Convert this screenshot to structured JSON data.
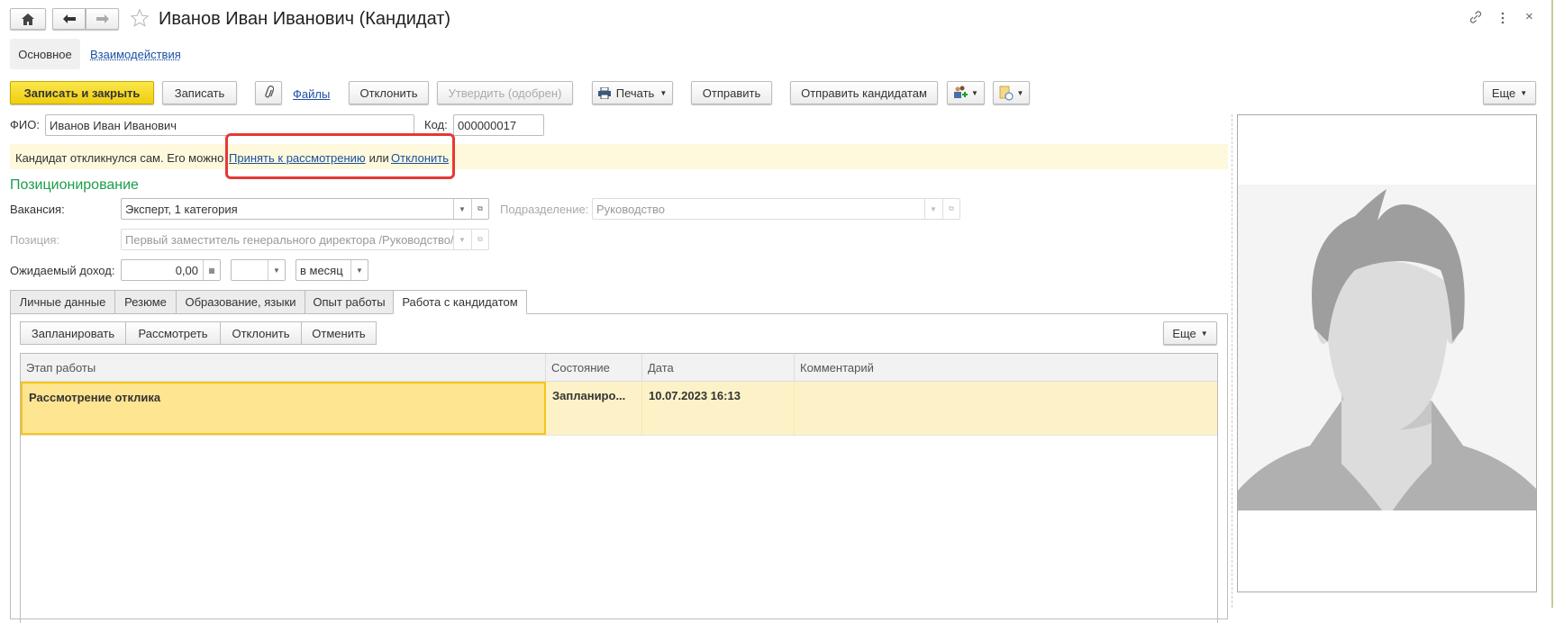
{
  "window": {
    "title": "Иванов Иван Иванович (Кандидат)"
  },
  "nav": {
    "home_icon": "home-icon",
    "back_icon": "arrow-left-icon",
    "forward_icon": "arrow-right-icon",
    "star_icon": "star-icon"
  },
  "form_tabs": [
    {
      "label": "Основное",
      "active": true
    },
    {
      "label": "Взаимодействия",
      "active": false
    }
  ],
  "toolbar": {
    "save_close": "Записать и закрыть",
    "save": "Записать",
    "files": "Файлы",
    "reject": "Отклонить",
    "approve": "Утвердить (одобрен)",
    "print": "Печать",
    "send": "Отправить",
    "send_candidates": "Отправить кандидатам",
    "more": "Еще"
  },
  "fields": {
    "fio_label": "ФИО:",
    "fio_value": "Иванов Иван Иванович",
    "code_label": "Код:",
    "code_value": "000000017"
  },
  "banner": {
    "text": "Кандидат откликнулся сам. Его можно ",
    "accept_link": "Принять к рассмотрению",
    "or": " или ",
    "reject_link": "Отклонить",
    "highlight_color": "#e53935"
  },
  "positioning": {
    "title": "Позиционирование",
    "vacancy_label": "Вакансия:",
    "vacancy_value": "Эксперт, 1 категория",
    "department_label": "Подразделение:",
    "department_value": "Руководство",
    "position_label": "Позиция:",
    "position_value": "Первый заместитель генерального директора /Руководство/",
    "income_label": "Ожидаемый доход:",
    "income_value": "0,00",
    "currency_value": "",
    "period_value": "в месяц"
  },
  "tabs": [
    {
      "label": "Личные данные"
    },
    {
      "label": "Резюме"
    },
    {
      "label": "Образование, языки"
    },
    {
      "label": "Опыт работы"
    },
    {
      "label": "Работа с кандидатом",
      "active": true
    }
  ],
  "work": {
    "buttons": [
      "Запланировать",
      "Рассмотреть",
      "Отклонить",
      "Отменить"
    ],
    "more": "Еще",
    "columns": [
      "Этап работы",
      "Состояние",
      "Дата",
      "Комментарий"
    ],
    "rows": [
      {
        "stage": "Рассмотрение отклика",
        "state": "Запланиро...",
        "date": "10.07.2023 16:13",
        "comment": ""
      }
    ]
  },
  "colors": {
    "accent_yellow": "#f5d618",
    "section_green": "#1a9e4b",
    "banner_bg": "#fef9dc"
  }
}
